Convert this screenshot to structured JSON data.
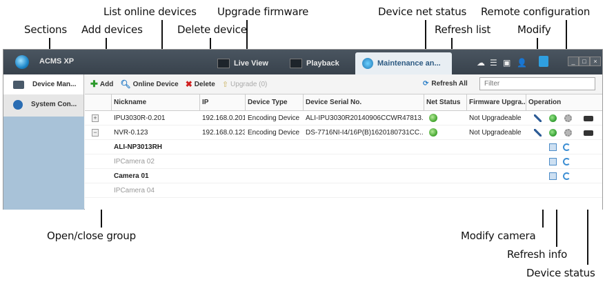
{
  "callouts": {
    "sections": "Sections",
    "add_devices": "Add devices",
    "list_online_devices": "List online devices",
    "delete_device": "Delete device",
    "upgrade_firmware": "Upgrade firmware",
    "device_net_status": "Device net status",
    "refresh_list": "Refresh list",
    "remote_configuration": "Remote configuration",
    "modify": "Modify",
    "open_close_group": "Open/close group",
    "modify_camera": "Modify camera",
    "refresh_info": "Refresh info",
    "device_status": "Device status"
  },
  "app": {
    "name": "ACMS XP",
    "tabs": [
      {
        "label": "Live View",
        "icon": "live-view-icon"
      },
      {
        "label": "Playback",
        "icon": "playback-icon"
      },
      {
        "label": "Maintenance an...",
        "icon": "maintenance-icon"
      }
    ]
  },
  "sidebar": {
    "items": [
      {
        "label": "Device Man...",
        "icon": "device-manager-icon"
      },
      {
        "label": "System Con...",
        "icon": "gear-icon"
      }
    ]
  },
  "toolbar": {
    "add": "Add",
    "online_device": "Online Device",
    "delete": "Delete",
    "upgrade": "Upgrade (0)",
    "refresh_all": "Refresh All",
    "filter_placeholder": "Filter"
  },
  "table": {
    "headers": [
      "Nickname",
      "IP",
      "Device Type",
      "Device Serial No.",
      "Net Status",
      "Firmware Upgra...",
      "Operation"
    ],
    "devices": [
      {
        "toggle": "+",
        "nickname": "IPU3030R-0.201",
        "ip": "192.168.0.201",
        "type": "Encoding Device",
        "serial": "ALI-IPU3030R20140906CCWR47813...",
        "net_status": "online",
        "firmware": "Not Upgradeable"
      },
      {
        "toggle": "−",
        "nickname": "NVR-0.123",
        "ip": "192.168.0.123",
        "type": "Encoding Device",
        "serial": "DS-7716NI-I4/16P(B)1620180731CC...",
        "net_status": "online",
        "firmware": "Not Upgradeable"
      }
    ],
    "cameras": [
      {
        "nickname": "ALI-NP3013RH",
        "dim": false
      },
      {
        "nickname": "IPCamera 02",
        "dim": true
      },
      {
        "nickname": "Camera 01",
        "dim": false
      },
      {
        "nickname": "IPCamera 04",
        "dim": true
      }
    ]
  }
}
